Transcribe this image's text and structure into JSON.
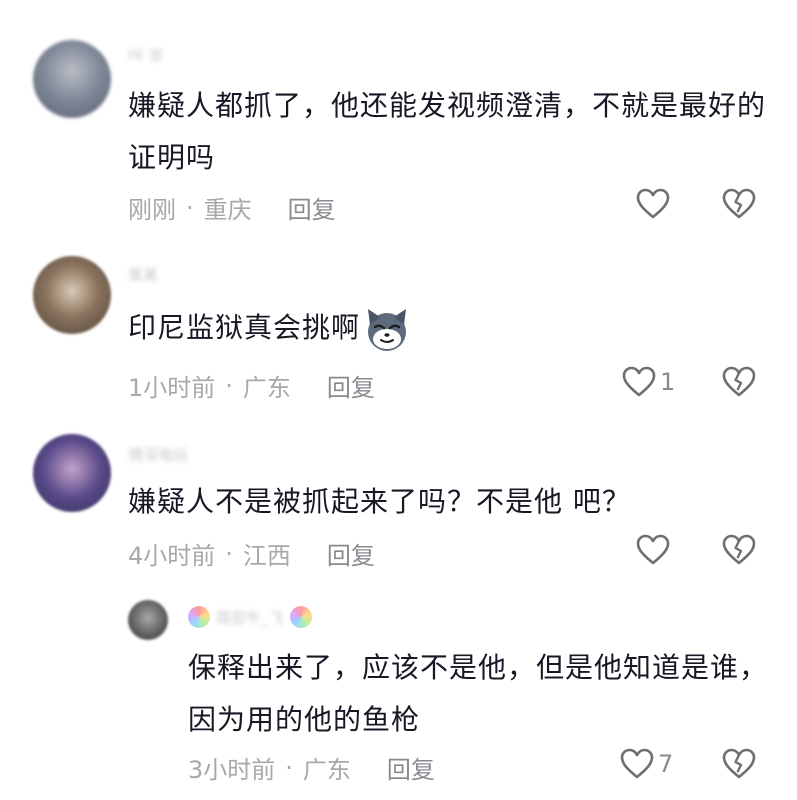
{
  "comments": [
    {
      "username": "Hi 龙",
      "text": "嫌疑人都抓了，他还能发视频澄清，不就是最好的证明吗",
      "time": "刚刚",
      "location": "重庆",
      "reply_label": "回复",
      "like_count": ""
    },
    {
      "username": "某某",
      "text": "印尼监狱真会挑啊",
      "emoji": "smug-cat-emoji",
      "time": "1小时前",
      "location": "广东",
      "reply_label": "回复",
      "like_count": "1"
    },
    {
      "username": "情深电玩",
      "text": "嫌疑人不是被抓起来了吗？不是他 吧？",
      "time": "4小时前",
      "location": "江西",
      "reply_label": "回复",
      "like_count": ""
    }
  ],
  "reply": {
    "username": "简若牛_飞",
    "text": "保释出来了，应该不是他，但是他知道是谁，因为用的他的鱼枪",
    "time": "3小时前",
    "location": "广东",
    "reply_label": "回复",
    "like_count": "7"
  },
  "separator": "·",
  "colors": {
    "text": "#161823",
    "meta": "#a8a8ac",
    "icon": "#6e6e73"
  }
}
